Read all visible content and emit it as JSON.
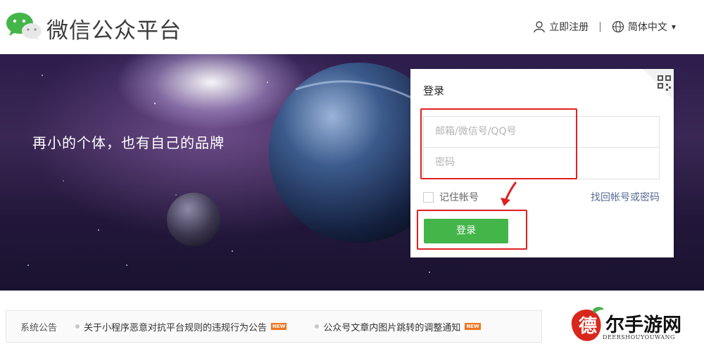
{
  "header": {
    "brand": "微信公众平台",
    "register": "立即注册",
    "separator": "|",
    "language": "简体中文"
  },
  "banner": {
    "slogan": "再小的个体，也有自己的品牌"
  },
  "login": {
    "title": "登录",
    "username_placeholder": "邮箱/微信号/QQ号",
    "password_placeholder": "密码",
    "remember": "记住帐号",
    "forgot": "找回帐号或密码",
    "submit": "登录"
  },
  "notices": {
    "label": "系统公告",
    "items": [
      {
        "text": "关于小程序恶意对抗平台规则的违规行为公告",
        "badge": "NEW"
      },
      {
        "text": "公众号文章内图片跳转的调整通知",
        "badge": "NEW"
      }
    ]
  },
  "watermark": {
    "char": "德",
    "text": "尔手游网",
    "sub": "DEERSHOUYOUWANG"
  },
  "colors": {
    "accent_green": "#44b549",
    "link_blue": "#576b95",
    "highlight_red": "#e02020",
    "badge_orange": "#f0731d"
  },
  "icons": [
    "wechat-logo-icon",
    "user-icon",
    "globe-icon",
    "caret-down-icon",
    "qrcode-icon",
    "arrow-annotation-icon"
  ]
}
